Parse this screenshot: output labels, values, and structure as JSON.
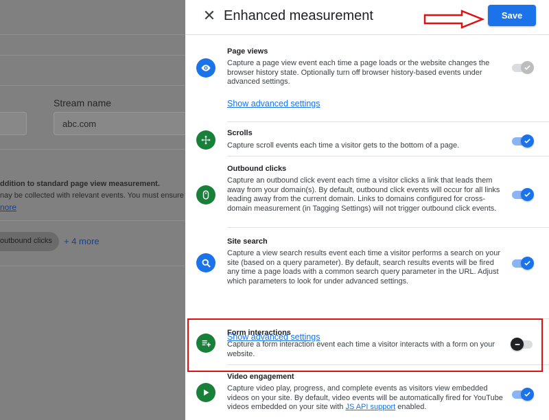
{
  "background": {
    "stream_name_label": "Stream name",
    "stream_name_value": "abc.com",
    "bold_text": "ddition to standard page view measurement.",
    "plain_text": "nay be collected with relevant events. You must ensure",
    "more_link": "nore",
    "chip_label": "outbound clicks",
    "plus_more": "+ 4 more"
  },
  "panel": {
    "title": "Enhanced measurement",
    "save_label": "Save",
    "settings": [
      {
        "title": "Page views",
        "description": "Capture a page view event each time a page loads or the website changes the browser history state. Optionally turn off browser history-based events under advanced settings.",
        "advanced_link": "Show advanced settings",
        "icon": "eye-icon",
        "state": "on-disabled"
      },
      {
        "title": "Scrolls",
        "description": "Capture scroll events each time a visitor gets to the bottom of a page.",
        "icon": "move-icon",
        "state": "on"
      },
      {
        "title": "Outbound clicks",
        "description": "Capture an outbound click event each time a visitor clicks a link that leads them away from your domain(s). By default, outbound click events will occur for all links leading away from the current domain. Links to domains configured for cross-domain measurement (in Tagging Settings) will not trigger outbound click events.",
        "icon": "mouse-icon",
        "state": "on"
      },
      {
        "title": "Site search",
        "description": "Capture a view search results event each time a visitor performs a search on your site (based on a query parameter). By default, search results events will be fired any time a page loads with a common search query parameter in the URL. Adjust which parameters to look for under advanced settings.",
        "advanced_link": "Show advanced settings",
        "icon": "search-icon",
        "state": "on"
      },
      {
        "title": "Form interactions",
        "description": "Capture a form interaction event each time a visitor interacts with a form on your website.",
        "icon": "form-icon",
        "state": "off"
      },
      {
        "title": "Video engagement",
        "description_prefix": "Capture video play, progress, and complete events as visitors view embedded videos on your site. By default, video events will be automatically fired for YouTube videos embedded on your site with ",
        "description_link": "JS API support",
        "description_suffix": " enabled.",
        "icon": "play-icon",
        "state": "on"
      }
    ]
  },
  "colors": {
    "accent": "#1a73e8",
    "icon_green": "#188038",
    "annotation_red": "#e01010"
  }
}
